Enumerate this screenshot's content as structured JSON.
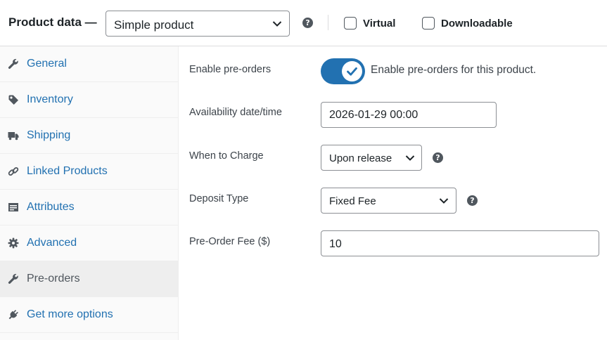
{
  "header": {
    "title": "Product data —",
    "product_type": "Simple product",
    "help": "?",
    "virtual_label": "Virtual",
    "virtual_checked": false,
    "downloadable_label": "Downloadable",
    "downloadable_checked": false
  },
  "sidebar": {
    "items": [
      {
        "label": "General",
        "icon": "wrench-icon",
        "active": false
      },
      {
        "label": "Inventory",
        "icon": "tag-icon",
        "active": false
      },
      {
        "label": "Shipping",
        "icon": "truck-icon",
        "active": false
      },
      {
        "label": "Linked Products",
        "icon": "link-icon",
        "active": false
      },
      {
        "label": "Attributes",
        "icon": "list-icon",
        "active": false
      },
      {
        "label": "Advanced",
        "icon": "gear-icon",
        "active": false
      },
      {
        "label": "Pre-orders",
        "icon": "wrench-icon",
        "active": true
      },
      {
        "label": "Get more options",
        "icon": "plug-icon",
        "active": false
      }
    ]
  },
  "form": {
    "enable": {
      "label": "Enable pre-orders",
      "checked": true,
      "description": "Enable pre-orders for this product."
    },
    "availability": {
      "label": "Availability date/time",
      "value": "2026-01-29 00:00"
    },
    "charge": {
      "label": "When to Charge",
      "value": "Upon release",
      "help": "?"
    },
    "deposit": {
      "label": "Deposit Type",
      "value": "Fixed Fee",
      "help": "?"
    },
    "fee": {
      "label": "Pre-Order Fee ($)",
      "value": "10"
    }
  },
  "colors": {
    "accent": "#2271b1",
    "text": "#1d2327",
    "muted": "#50575e",
    "border": "#8c8f94"
  }
}
